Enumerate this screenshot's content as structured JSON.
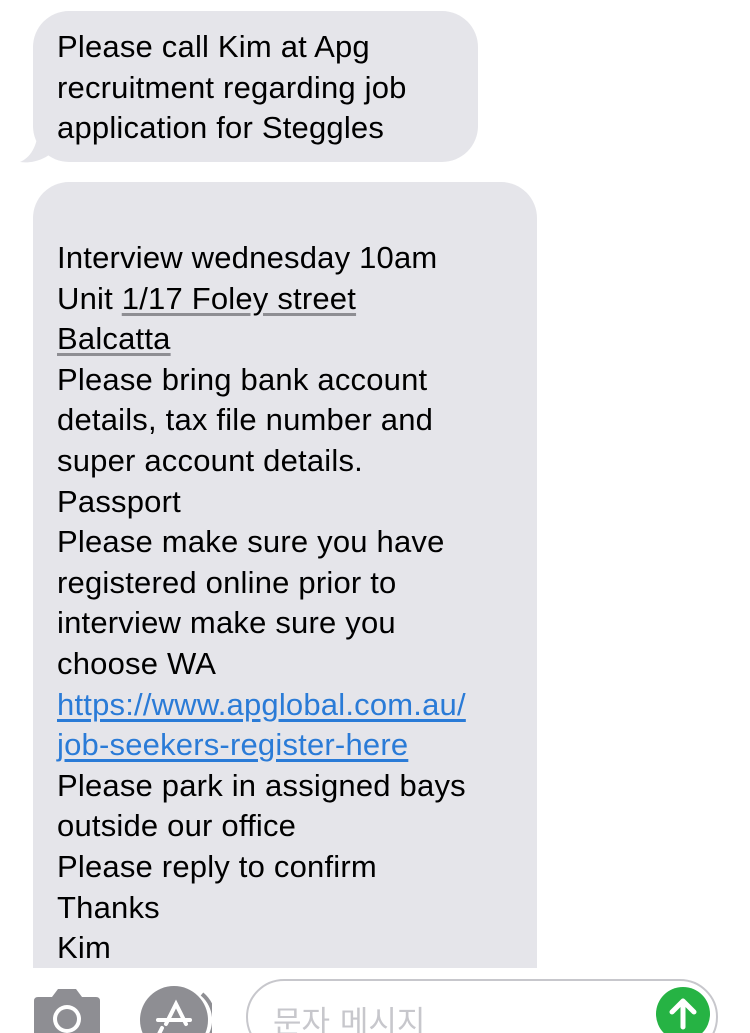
{
  "messages": [
    {
      "lines": [
        "Please call Kim at Apg",
        "recruitment regarding job",
        "application for Steggles"
      ]
    },
    {
      "line_interview": "Interview wednesday 10am",
      "unit_prefix": "Unit ",
      "unit_address": "1/17 Foley street",
      "suburb": "Balcatta",
      "lines_a": [
        "Please bring bank account",
        "details, tax file number and",
        "super account details.",
        "Passport",
        "Please make sure you have",
        "registered online prior to",
        "interview make sure you",
        "choose WA"
      ],
      "link_line1": "https://www.apglobal.com.au/",
      "link_line2": "job-seekers-register-here",
      "lines_b": [
        "Please park in assigned bays",
        "outside our office",
        "Please reply to confirm",
        "Thanks",
        "Kim"
      ]
    }
  ],
  "input_bar": {
    "placeholder": "문자 메시지",
    "camera_icon": "camera-icon",
    "appstore_icon": "app-store-icon",
    "send_icon": "arrow-up-icon",
    "send_color": "#26b344"
  },
  "colors": {
    "bubble_incoming": "#e5e5ea",
    "link": "#2a7bd7"
  }
}
